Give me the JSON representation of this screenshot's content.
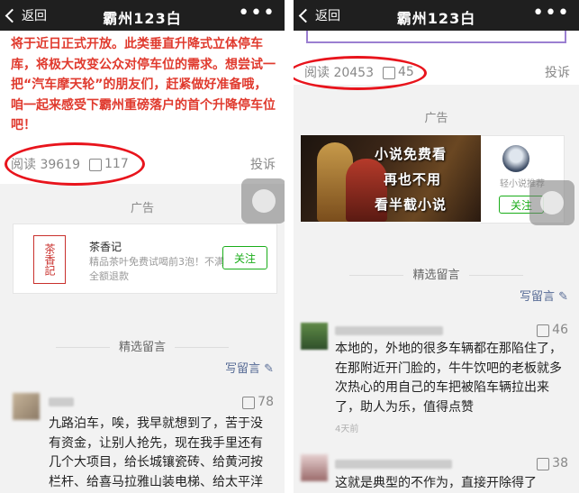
{
  "left": {
    "nav": {
      "back_label": "返回",
      "title": "霸州123白",
      "more": "•••"
    },
    "article_text": "将于近日正式开放。此类垂直升降式立体停车库，将极大改变公众对停车位的需求。想尝试一把“汽车摩天轮”的朋友们，赶紧做好准备哦，咱一起来感受下霸州重磅落户的首个升降停车位吧！",
    "stats": {
      "read_label": "阅读",
      "read_count": "39619",
      "likes": "117",
      "report": "投诉"
    },
    "ad": {
      "label": "广告",
      "logo_text": "茶香記",
      "name": "茶香记",
      "desc": "精品茶叶免费试喝前3泡！不满全额退款",
      "follow": "关注"
    },
    "comments_section": {
      "title": "精选留言",
      "write": "写留言"
    },
    "comments": [
      {
        "likes": "78",
        "text": "九路泊车，唉，我早就想到了，苦于没有资金，让别人抢先，现在我手里还有几个大项目，给长城镶瓷砖、给黄河按栏杆、给喜马拉雅山装电梯、给太平洋"
      }
    ]
  },
  "right": {
    "nav": {
      "back_label": "返回",
      "title": "霸州123白",
      "more": "•••"
    },
    "stats": {
      "read_label": "阅读",
      "read_count": "20453",
      "likes": "45",
      "report": "投诉"
    },
    "ad": {
      "label": "广告",
      "banner_lines": [
        "小说免费看",
        "再也不用",
        "看半截小说"
      ],
      "side_name": "轻小说推荐",
      "follow": "关注"
    },
    "comments_section": {
      "title": "精选留言",
      "write": "写留言"
    },
    "comments": [
      {
        "likes": "46",
        "text": "本地的，外地的很多车辆都在那陷住了，在那附近开门脸的，牛牛饮吧的老板就多次热心的用自己的车把被陷车辆拉出来了，助人为乐，值得点赞",
        "time": "4天前"
      },
      {
        "likes": "38",
        "text": "这就是典型的不作为，直接开除得了"
      }
    ]
  },
  "colors": {
    "red_text": "#e03a2e",
    "annotation_red": "#e8141c",
    "link_blue": "#576b95",
    "follow_green": "#1aad19"
  }
}
